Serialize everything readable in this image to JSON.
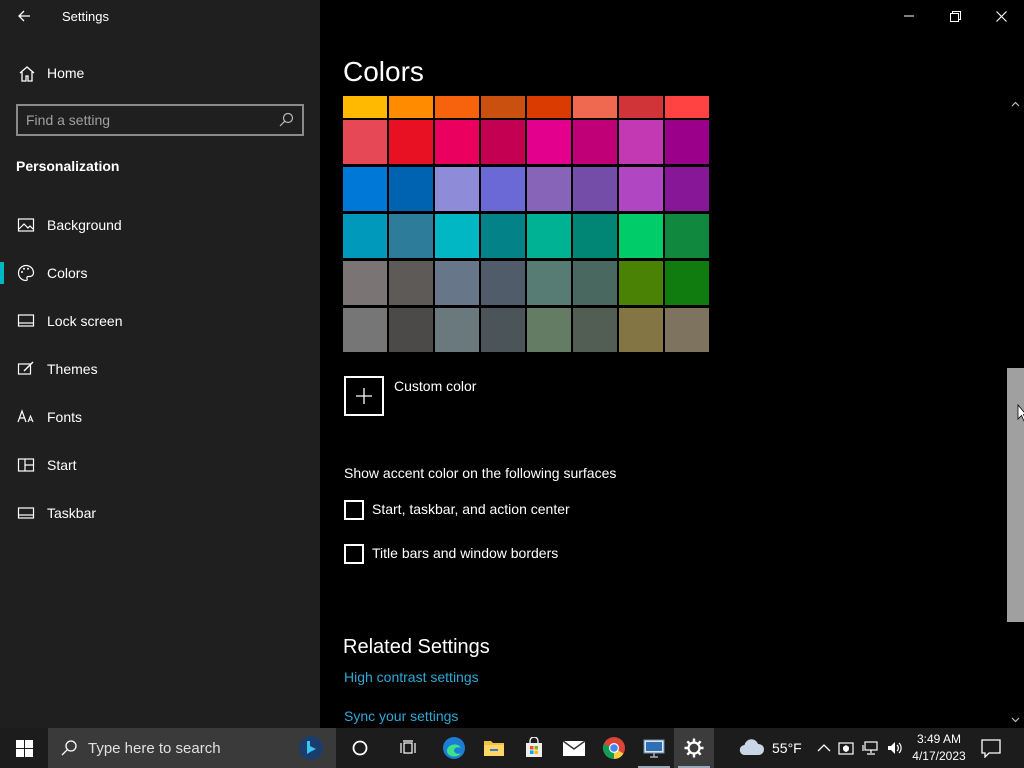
{
  "window": {
    "title": "Settings",
    "controls": [
      "minimize",
      "maximize",
      "close"
    ]
  },
  "sidebar": {
    "home_label": "Home",
    "search_placeholder": "Find a setting",
    "section": "Personalization",
    "items": [
      {
        "label": "Background",
        "icon": "picture-icon",
        "selected": false
      },
      {
        "label": "Colors",
        "icon": "palette-icon",
        "selected": true
      },
      {
        "label": "Lock screen",
        "icon": "lock-screen-icon",
        "selected": false
      },
      {
        "label": "Themes",
        "icon": "themes-brush-icon",
        "selected": false
      },
      {
        "label": "Fonts",
        "icon": "font-icon",
        "selected": false
      },
      {
        "label": "Start",
        "icon": "start-grid-icon",
        "selected": false
      },
      {
        "label": "Taskbar",
        "icon": "taskbar-icon",
        "selected": false
      }
    ],
    "accent_color": "#00b7c3"
  },
  "main": {
    "title": "Colors",
    "swatch_rows": [
      [
        "#FFB900",
        "#FF8C00",
        "#F7630C",
        "#CA5010",
        "#DA3B01",
        "#EF6950",
        "#D13438",
        "#FF4343"
      ],
      [
        "#E74856",
        "#E81123",
        "#EA005E",
        "#C30052",
        "#E3008C",
        "#BF0077",
        "#C239B3",
        "#9A0089"
      ],
      [
        "#0078D7",
        "#0063B1",
        "#8E8CD8",
        "#6B69D6",
        "#8764B8",
        "#744DA9",
        "#B146C2",
        "#881798"
      ],
      [
        "#0099BC",
        "#2D7D9A",
        "#00B7C3",
        "#038387",
        "#00B294",
        "#018574",
        "#00CC6A",
        "#10893E"
      ],
      [
        "#7A7574",
        "#5D5A58",
        "#68768A",
        "#515C6B",
        "#567C73",
        "#486860",
        "#498205",
        "#107C10"
      ],
      [
        "#767676",
        "#4C4A48",
        "#69797E",
        "#4A5459",
        "#647C64",
        "#525E54",
        "#847545",
        "#7E735F"
      ]
    ],
    "custom_color_label": "Custom color",
    "surfaces_header": "Show accent color on the following surfaces",
    "checkboxes": [
      {
        "label": "Start, taskbar, and action center",
        "checked": false
      },
      {
        "label": "Title bars and window borders",
        "checked": false
      }
    ],
    "related_header": "Related Settings",
    "links": [
      "High contrast settings",
      "Sync your settings"
    ],
    "link_color": "#2ea8d6"
  },
  "taskbar": {
    "search_placeholder": "Type here to search",
    "pinned": [
      "cortana-circle-icon",
      "task-view-icon",
      "edge-icon",
      "file-explorer-icon",
      "microsoft-store-icon",
      "mail-icon",
      "chrome-icon",
      "remote-desktop-icon",
      "settings-gear-icon"
    ],
    "weather": {
      "temp": "55°F",
      "icon": "cloud-icon"
    },
    "clock": {
      "time": "3:49 AM",
      "date": "4/17/2023"
    }
  }
}
